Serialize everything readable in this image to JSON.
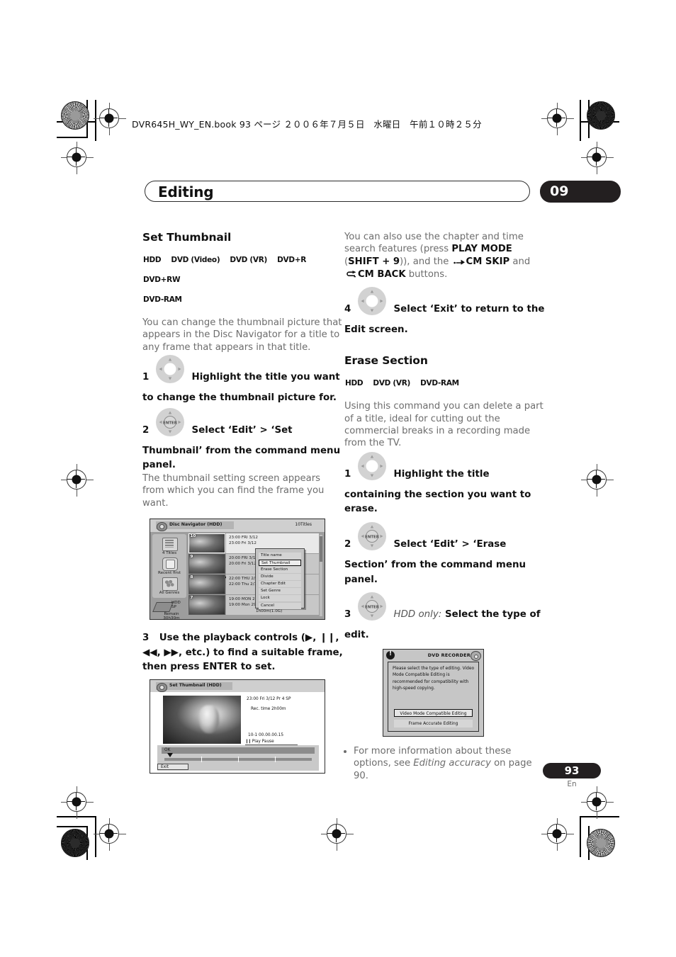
{
  "print_header": {
    "book_line": "DVR645H_WY_EN.book  93 ページ  ２００６年７月５日　水曜日　午前１０時２５分"
  },
  "chapter": {
    "title": "Editing",
    "number": "09"
  },
  "left_column": {
    "section_title": "Set Thumbnail",
    "badges": [
      "HDD",
      "DVD (Video)",
      "DVD (VR)",
      "DVD+R",
      "DVD+RW",
      "DVD-RAM"
    ],
    "intro": "You can change the thumbnail picture that appears in the Disc Navigator for a title to any frame that appears in that title.",
    "steps": [
      {
        "num": "1",
        "icon": "cursor-pad-icon",
        "text": "Highlight the title you want to change the thumbnail picture for."
      },
      {
        "num": "2",
        "icon": "enter-pad-icon",
        "text": "Select ‘Edit’ > ‘Set Thumbnail’ from the command menu panel.",
        "note": "The thumbnail setting screen appears from which you can find the frame you want."
      },
      {
        "num": "3",
        "icon": null,
        "text_prefix": "Use the playback controls (",
        "text_mid": ", etc.) to find a suitable frame, then press ENTER to set.",
        "glyphs_a": [
          "▶",
          "❙❙",
          "◀◀"
        ],
        "glyphs_b": [
          "▶▶"
        ]
      }
    ]
  },
  "disc_navigator_screen": {
    "title": "Disc Navigator  (HDD)",
    "titles_count": "10Titles",
    "sidebar": {
      "items": [
        {
          "icon": "list-icon",
          "label": "4 Titles"
        },
        {
          "icon": "sort-icon",
          "label": "Recent first"
        },
        {
          "icon": "genre-icon",
          "label": "All Genres"
        }
      ],
      "hdd_label": "HDD",
      "hdd_mode": "SP",
      "remain_label": "Remain",
      "remain_value": "30h30m"
    },
    "rows": [
      {
        "thumb_num": "10",
        "line1": "23:00  FRI    3/12",
        "line2": "23:00   Fri    3/12",
        "line3": "",
        "selected": true
      },
      {
        "thumb_num": "9",
        "line1": "20:00   FRI    3/12",
        "line2": "20:00   Fri    3/12",
        "line3": "",
        "selected": false
      },
      {
        "thumb_num": "8",
        "line1": "22:00   THU   2/12",
        "line2": "22:00   Thu   2/12",
        "line3": "",
        "selected": false
      },
      {
        "thumb_num": "7",
        "line1": "19:00   MON  29/11",
        "line2": "19:00   Mon  29/11      Pr 2    SP",
        "line3": "1h00m(1.0G)",
        "selected": false
      }
    ],
    "command_menu": {
      "items": [
        {
          "label": "Title name",
          "highlighted": false
        },
        {
          "label": "Set Thumbnail",
          "highlighted": true
        },
        {
          "label": "Erase Section",
          "highlighted": false
        },
        {
          "label": "Divide",
          "highlighted": false
        },
        {
          "label": "Chapter Edit",
          "highlighted": false
        },
        {
          "label": "Set Genre",
          "highlighted": false
        },
        {
          "label": "Lock",
          "highlighted": false
        },
        {
          "label": "Cancel",
          "highlighted": false
        }
      ]
    }
  },
  "set_thumbnail_screen": {
    "title": "Set Thumbnail  (HDD)",
    "info_line1": "23:00  Fri  3/12  Pr 4    SP",
    "info_line2": "Rec. time          2h00m",
    "info_line3": "10-1    00.00.00.15",
    "play_pause": "Play Pause",
    "ok_label": "OK",
    "exit_label": "Exit"
  },
  "right_column": {
    "para_top_a": "You can also use the chapter and time search features (press ",
    "para_top_play_mode": "PLAY MODE",
    "para_top_b": " (",
    "para_top_shift": "SHIFT + 9",
    "para_top_c": ")), and the ",
    "para_top_cm_skip": "CM SKIP",
    "para_top_and": " and ",
    "para_top_cm_back": "CM BACK",
    "para_top_d": " buttons.",
    "step4": {
      "num": "4",
      "icon": "cursor-pad-icon",
      "text": "Select ‘Exit’ to return to the Edit screen."
    },
    "section_title": "Erase Section",
    "badges": [
      "HDD",
      "DVD (VR)",
      "DVD-RAM"
    ],
    "intro": "Using this command you can delete a part of a title, ideal for cutting out the commercial breaks in a recording made from the TV.",
    "steps": [
      {
        "num": "1",
        "icon": "cursor-pad-icon",
        "text": "Highlight the title containing the section you want to erase."
      },
      {
        "num": "2",
        "icon": "enter-pad-icon",
        "text": "Select ‘Edit’ > ‘Erase Section’ from the command menu panel."
      },
      {
        "num": "3",
        "icon": "enter-pad-icon",
        "italic": "HDD only:",
        "text": " Select the type of edit."
      }
    ],
    "bullet": {
      "part_a": "For more information about these options, see ",
      "italic": "Editing accuracy",
      "part_b": " on page 90."
    }
  },
  "dvd_recorder_dialog": {
    "title": "DVD RECORDER",
    "message": "Please select the type of editing. Video Mode Compatible Editing is recommended for compatibility with high-speed copying.",
    "buttons": [
      {
        "label": "Video Mode Compatible Editing",
        "selected": true
      },
      {
        "label": "Frame Accurate Editing",
        "selected": false
      }
    ]
  },
  "footer": {
    "page_number": "93",
    "language": "En"
  }
}
